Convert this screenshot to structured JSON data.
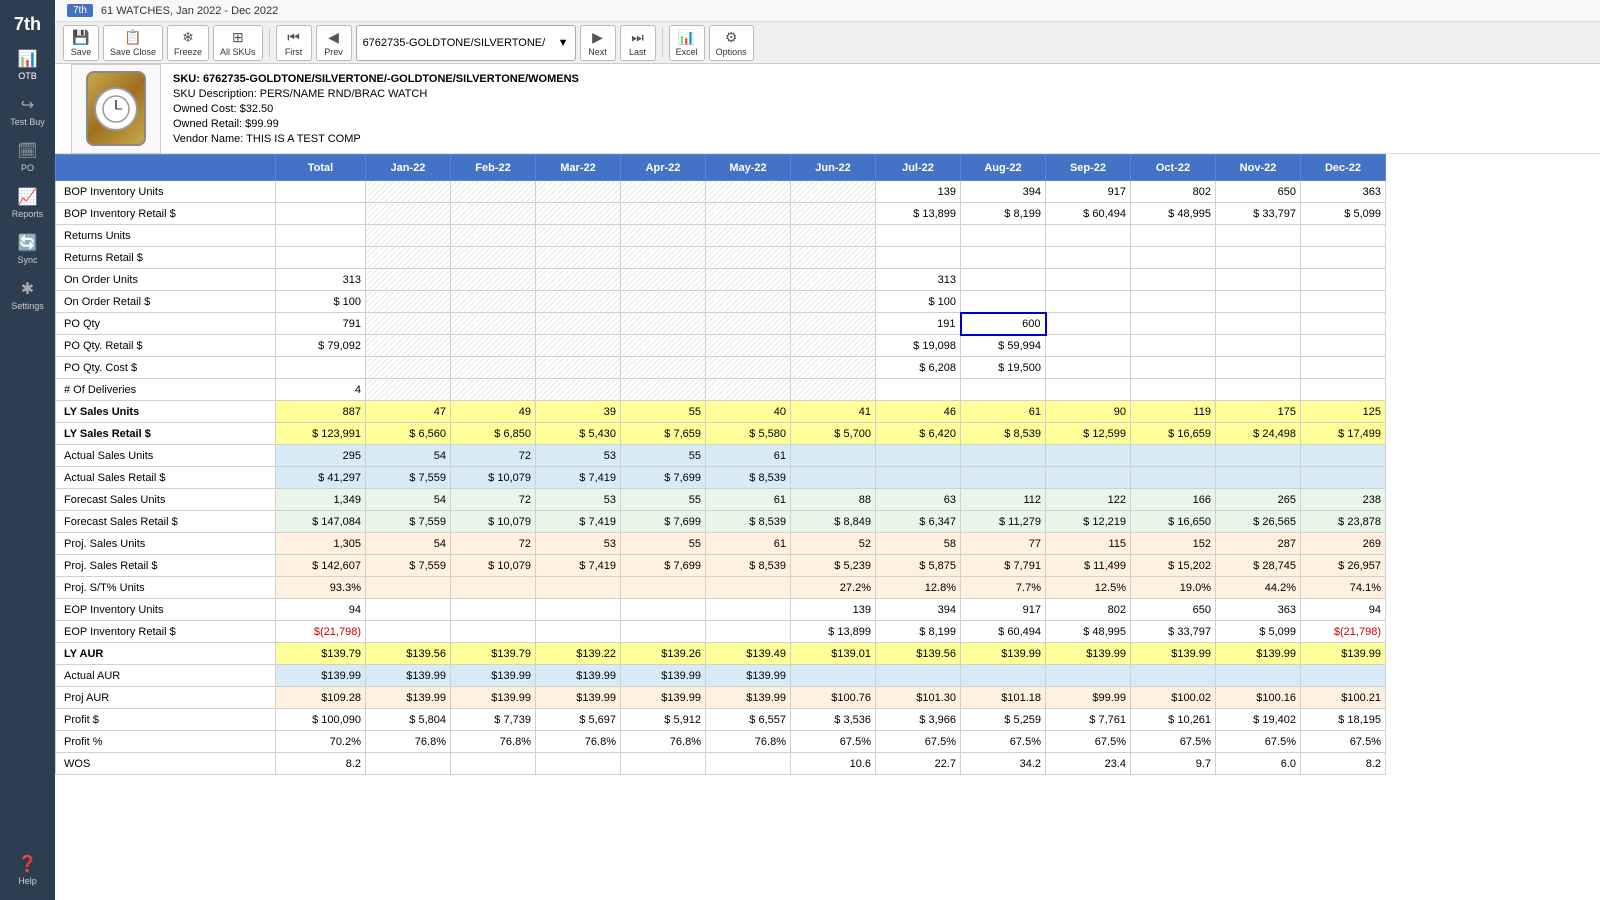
{
  "sidebar": {
    "logo": "7th",
    "items": [
      {
        "id": "otb",
        "label": "OTB",
        "icon": "📊"
      },
      {
        "id": "save",
        "label": "Save",
        "icon": "💾"
      },
      {
        "id": "save-close",
        "label": "Save Close",
        "icon": "📋"
      },
      {
        "id": "test-buy",
        "label": "Test Buy",
        "icon": "↪"
      },
      {
        "id": "po",
        "label": "PO",
        "icon": "🗓"
      },
      {
        "id": "reports",
        "label": "Reports",
        "icon": "📈"
      },
      {
        "id": "sync",
        "label": "Sync",
        "icon": "🔄"
      },
      {
        "id": "settings",
        "label": "Settings",
        "icon": "✱"
      },
      {
        "id": "help",
        "label": "Help",
        "icon": "?"
      }
    ]
  },
  "page_title": "61 WATCHES, Jan 2022 - Dec 2022",
  "toolbar": {
    "save_label": "Save",
    "save_close_label": "Save Close",
    "freeze_label": "Freeze",
    "all_skus_label": "All SKUs",
    "first_label": "First",
    "prev_label": "Prev",
    "sku_dropdown": "6762735-GOLDTONE/SILVERTONE/",
    "next_label": "Next",
    "last_label": "Last",
    "excel_label": "Excel",
    "options_label": "Options"
  },
  "product": {
    "sku": "SKU: 6762735-GOLDTONE/SILVERTONE/-GOLDTONE/SILVERTONE/WOMENS",
    "description": "SKU Description: PERS/NAME RND/BRAC WATCH",
    "owned_cost": "Owned Cost: $32.50",
    "owned_retail": "Owned Retail: $99.99",
    "vendor_name": "Vendor Name: THIS IS A TEST COMP"
  },
  "table": {
    "headers": [
      "",
      "Total",
      "Jan-22",
      "Feb-22",
      "Mar-22",
      "Apr-22",
      "May-22",
      "Jun-22",
      "Jul-22",
      "Aug-22",
      "Sep-22",
      "Oct-22",
      "Nov-22",
      "Dec-22"
    ],
    "rows": [
      {
        "label": "BOP Inventory Units",
        "type": "normal",
        "total": "",
        "jan": "",
        "feb": "",
        "mar": "",
        "apr": "",
        "may": "",
        "jun": "",
        "jul": "139",
        "aug": "394",
        "sep": "917",
        "oct": "802",
        "nov": "650",
        "dec": "363"
      },
      {
        "label": "BOP Inventory Retail $",
        "type": "normal",
        "total": "",
        "jan": "",
        "feb": "",
        "mar": "",
        "apr": "",
        "may": "",
        "jun": "",
        "jul": "$ 13,899",
        "aug": "$ 8,199",
        "sep": "$ 60,494",
        "oct": "$ 48,995",
        "nov": "$ 33,797",
        "dec": "$ 5,099"
      },
      {
        "label": "Returns Units",
        "type": "normal",
        "total": "",
        "jan": "",
        "feb": "",
        "mar": "",
        "apr": "",
        "may": "",
        "jun": "",
        "jul": "",
        "aug": "",
        "sep": "",
        "oct": "",
        "nov": "",
        "dec": ""
      },
      {
        "label": "Returns Retail $",
        "type": "normal",
        "total": "",
        "jan": "",
        "feb": "",
        "mar": "",
        "apr": "",
        "may": "",
        "jun": "",
        "jul": "",
        "aug": "",
        "sep": "",
        "oct": "",
        "nov": "",
        "dec": ""
      },
      {
        "label": "On Order Units",
        "type": "normal",
        "total": "313",
        "jan": "",
        "feb": "",
        "mar": "",
        "apr": "",
        "may": "",
        "jun": "",
        "jul": "313",
        "aug": "",
        "sep": "",
        "oct": "",
        "nov": "",
        "dec": ""
      },
      {
        "label": "On Order Retail $",
        "type": "normal",
        "total": "$ 100",
        "jan": "",
        "feb": "",
        "mar": "",
        "apr": "",
        "may": "",
        "jun": "",
        "jul": "$ 100",
        "aug": "",
        "sep": "",
        "oct": "",
        "nov": "",
        "dec": ""
      },
      {
        "label": "PO Qty",
        "type": "normal",
        "total": "791",
        "jan": "",
        "feb": "",
        "mar": "",
        "apr": "",
        "may": "",
        "jun": "",
        "jul": "191",
        "aug": "600",
        "sep": "",
        "oct": "",
        "nov": "",
        "dec": ""
      },
      {
        "label": "PO Qty. Retail $",
        "type": "normal",
        "total": "$ 79,092",
        "jan": "",
        "feb": "",
        "mar": "",
        "apr": "",
        "may": "",
        "jun": "",
        "jul": "$ 19,098",
        "aug": "$ 59,994",
        "sep": "",
        "oct": "",
        "nov": "",
        "dec": ""
      },
      {
        "label": "PO Qty. Cost $",
        "type": "normal",
        "total": "",
        "jan": "",
        "feb": "",
        "mar": "",
        "apr": "",
        "may": "",
        "jun": "",
        "jul": "$ 6,208",
        "aug": "$ 19,500",
        "sep": "",
        "oct": "",
        "nov": "",
        "dec": ""
      },
      {
        "label": "# Of Deliveries",
        "type": "normal",
        "total": "4",
        "jan": "",
        "feb": "",
        "mar": "",
        "apr": "",
        "may": "",
        "jun": "",
        "jul": "",
        "aug": "",
        "sep": "",
        "oct": "",
        "nov": "",
        "dec": ""
      },
      {
        "label": "LY Sales Units",
        "type": "ly",
        "total": "887",
        "jan": "47",
        "feb": "49",
        "mar": "39",
        "apr": "55",
        "may": "40",
        "jun": "41",
        "jul": "46",
        "aug": "61",
        "sep": "90",
        "oct": "119",
        "nov": "175",
        "dec": "125"
      },
      {
        "label": "LY Sales Retail $",
        "type": "ly",
        "total": "$ 123,991",
        "jan": "$ 6,560",
        "feb": "$ 6,850",
        "mar": "$ 5,430",
        "apr": "$ 7,659",
        "may": "$ 5,580",
        "jun": "$ 5,700",
        "jul": "$ 6,420",
        "aug": "$ 8,539",
        "sep": "$ 12,599",
        "oct": "$ 16,659",
        "nov": "$ 24,498",
        "dec": "$ 17,499"
      },
      {
        "label": "Actual Sales Units",
        "type": "actual",
        "total": "295",
        "jan": "54",
        "feb": "72",
        "mar": "53",
        "apr": "55",
        "may": "61",
        "jun": "",
        "jul": "",
        "aug": "",
        "sep": "",
        "oct": "",
        "nov": "",
        "dec": ""
      },
      {
        "label": "Actual Sales Retail $",
        "type": "actual",
        "total": "$ 41,297",
        "jan": "$ 7,559",
        "feb": "$ 10,079",
        "mar": "$ 7,419",
        "apr": "$ 7,699",
        "may": "$ 8,539",
        "jun": "",
        "jul": "",
        "aug": "",
        "sep": "",
        "oct": "",
        "nov": "",
        "dec": ""
      },
      {
        "label": "Forecast Sales Units",
        "type": "forecast",
        "total": "1,349",
        "jan": "54",
        "feb": "72",
        "mar": "53",
        "apr": "55",
        "may": "61",
        "jun": "88",
        "jul": "63",
        "aug": "112",
        "sep": "122",
        "oct": "166",
        "nov": "265",
        "dec": "238"
      },
      {
        "label": "Forecast Sales Retail $",
        "type": "forecast",
        "total": "$ 147,084",
        "jan": "$ 7,559",
        "feb": "$ 10,079",
        "mar": "$ 7,419",
        "apr": "$ 7,699",
        "may": "$ 8,539",
        "jun": "$ 8,849",
        "jul": "$ 6,347",
        "aug": "$ 11,279",
        "sep": "$ 12,219",
        "oct": "$ 16,650",
        "nov": "$ 26,565",
        "dec": "$ 23,878"
      },
      {
        "label": "Proj. Sales Units",
        "type": "proj",
        "total": "1,305",
        "jan": "54",
        "feb": "72",
        "mar": "53",
        "apr": "55",
        "may": "61",
        "jun": "52",
        "jul": "58",
        "aug": "77",
        "sep": "115",
        "oct": "152",
        "nov": "287",
        "dec": "269"
      },
      {
        "label": "Proj. Sales Retail $",
        "type": "proj",
        "total": "$ 142,607",
        "jan": "$ 7,559",
        "feb": "$ 10,079",
        "mar": "$ 7,419",
        "apr": "$ 7,699",
        "may": "$ 8,539",
        "jun": "$ 5,239",
        "jul": "$ 5,875",
        "aug": "$ 7,791",
        "sep": "$ 11,499",
        "oct": "$ 15,202",
        "nov": "$ 28,745",
        "dec": "$ 26,957"
      },
      {
        "label": "Proj. S/T% Units",
        "type": "proj",
        "total": "93.3%",
        "jan": "",
        "feb": "",
        "mar": "",
        "apr": "",
        "may": "",
        "jun": "27.2%",
        "jul": "12.8%",
        "aug": "7.7%",
        "sep": "12.5%",
        "oct": "19.0%",
        "nov": "44.2%",
        "dec": "74.1%"
      },
      {
        "label": "EOP Inventory Units",
        "type": "eop",
        "total": "94",
        "jan": "",
        "feb": "",
        "mar": "",
        "apr": "",
        "may": "",
        "jun": "139",
        "jul": "394",
        "aug": "917",
        "sep": "802",
        "oct": "650",
        "nov": "363",
        "dec": "94"
      },
      {
        "label": "EOP Inventory Retail $",
        "type": "eop",
        "total": "$(21,798)",
        "total_red": true,
        "jan": "",
        "feb": "",
        "mar": "",
        "apr": "",
        "may": "",
        "jun": "$ 13,899",
        "jul": "$ 8,199",
        "aug": "$ 60,494",
        "sep": "$ 48,995",
        "oct": "$ 33,797",
        "nov": "$ 5,099",
        "dec": "$(21,798)",
        "dec_red": true
      },
      {
        "label": "LY AUR",
        "type": "ly",
        "total": "$139.79",
        "jan": "$139.56",
        "feb": "$139.79",
        "mar": "$139.22",
        "apr": "$139.26",
        "may": "$139.49",
        "jun": "$139.01",
        "jul": "$139.56",
        "aug": "$139.99",
        "sep": "$139.99",
        "oct": "$139.99",
        "nov": "$139.99",
        "dec": "$139.99"
      },
      {
        "label": "Actual AUR",
        "type": "actual",
        "total": "$139.99",
        "jan": "$139.99",
        "feb": "$139.99",
        "mar": "$139.99",
        "apr": "$139.99",
        "may": "$139.99",
        "jun": "",
        "jul": "",
        "aug": "",
        "sep": "",
        "oct": "",
        "nov": "",
        "dec": ""
      },
      {
        "label": "Proj AUR",
        "type": "proj",
        "total": "$109.28",
        "jan": "$139.99",
        "feb": "$139.99",
        "mar": "$139.99",
        "apr": "$139.99",
        "may": "$139.99",
        "jun": "$100.76",
        "jul": "$101.30",
        "aug": "$101.18",
        "sep": "$99.99",
        "oct": "$100.02",
        "nov": "$100.16",
        "dec": "$100.21"
      },
      {
        "label": "Profit $",
        "type": "normal",
        "total": "$ 100,090",
        "jan": "$ 5,804",
        "feb": "$ 7,739",
        "mar": "$ 5,697",
        "apr": "$ 5,912",
        "may": "$ 6,557",
        "jun": "$ 3,536",
        "jul": "$ 3,966",
        "aug": "$ 5,259",
        "sep": "$ 7,761",
        "oct": "$ 10,261",
        "nov": "$ 19,402",
        "dec": "$ 18,195"
      },
      {
        "label": "Profit %",
        "type": "normal",
        "total": "70.2%",
        "jan": "76.8%",
        "feb": "76.8%",
        "mar": "76.8%",
        "apr": "76.8%",
        "may": "76.8%",
        "jun": "67.5%",
        "jul": "67.5%",
        "aug": "67.5%",
        "sep": "67.5%",
        "oct": "67.5%",
        "nov": "67.5%",
        "dec": "67.5%"
      },
      {
        "label": "WOS",
        "type": "normal",
        "total": "8.2",
        "jan": "",
        "feb": "",
        "mar": "",
        "apr": "",
        "may": "",
        "jun": "10.6",
        "jul": "22.7",
        "aug": "34.2",
        "sep": "23.4",
        "oct": "9.7",
        "nov": "6.0",
        "dec": "8.2"
      }
    ]
  },
  "icons": {
    "save": "💾",
    "save_close": "📋",
    "freeze": "🧊",
    "all_skus": "⊞",
    "first": "⏮",
    "prev": "◀",
    "next": "▶",
    "last": "⏭",
    "excel": "📊",
    "options": "⚙"
  }
}
